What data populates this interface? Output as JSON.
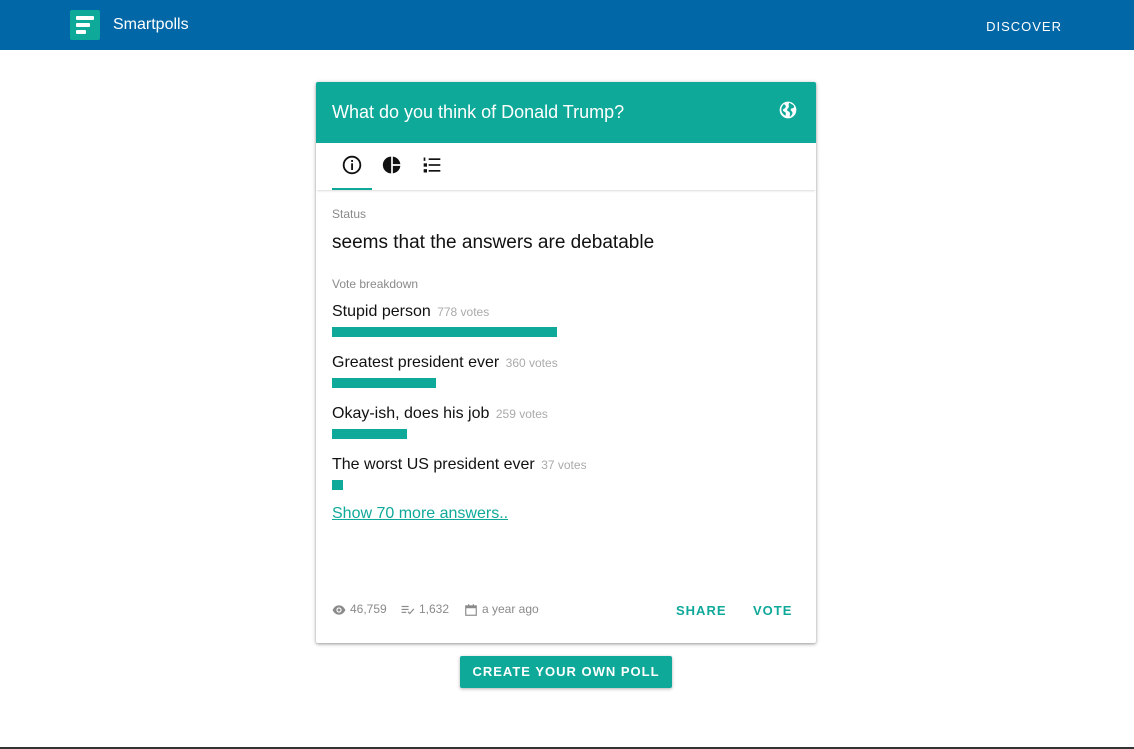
{
  "app": {
    "brand": "Smartpolls",
    "nav_discover": "DISCOVER",
    "accent": "#0fa99a",
    "header_color": "#0267a6"
  },
  "poll": {
    "title": "What do you think of Donald Trump?",
    "tabs": [
      {
        "name": "info",
        "icon": "info-icon",
        "active": true
      },
      {
        "name": "chart",
        "icon": "pie-chart-icon",
        "active": false
      },
      {
        "name": "list",
        "icon": "list-icon",
        "active": false
      }
    ],
    "status_label": "Status",
    "status_text": "seems that the answers are debatable",
    "breakdown_label": "Vote breakdown",
    "answers": [
      {
        "label": "Stupid person",
        "votes": 778,
        "votes_text": "778 votes"
      },
      {
        "label": "Greatest president ever",
        "votes": 360,
        "votes_text": "360 votes"
      },
      {
        "label": "Okay-ish, does his job",
        "votes": 259,
        "votes_text": "259 votes"
      },
      {
        "label": "The worst US president ever",
        "votes": 37,
        "votes_text": "37 votes"
      }
    ],
    "more_answers_link": "Show 70 more answers..",
    "stats": {
      "views": "46,759",
      "votes": "1,632",
      "age": "a year ago"
    },
    "share_label": "SHARE",
    "vote_label": "VOTE"
  },
  "create_poll_label": "CREATE YOUR OWN POLL"
}
